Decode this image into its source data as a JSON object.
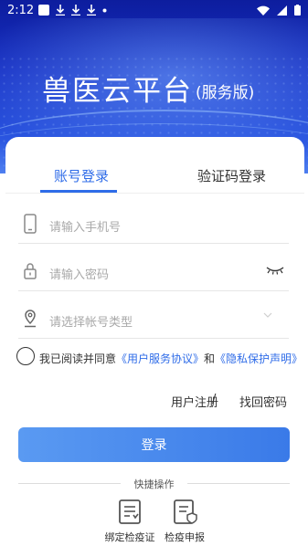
{
  "status_bar": {
    "time": "2:12"
  },
  "header": {
    "title": "兽医云平台",
    "subtitle": "(服务版)"
  },
  "tabs": [
    {
      "label": "账号登录",
      "active": true
    },
    {
      "label": "验证码登录",
      "active": false
    }
  ],
  "form": {
    "phone_placeholder": "请输入手机号",
    "password_placeholder": "请输入密码",
    "account_type_placeholder": "请选择帐号类型"
  },
  "agreement": {
    "prefix": "我已阅读并同意",
    "service_link": "《用户服务协议》",
    "and": "和",
    "privacy_link": "《隐私保护声明》"
  },
  "links": {
    "register": "用户注册",
    "separator": "/",
    "forgot": "找回密码"
  },
  "login_button": "登录",
  "quick_ops": {
    "title": "快捷操作",
    "items": [
      {
        "label": "绑定检疫证",
        "icon": "certificate-icon"
      },
      {
        "label": "检疫申报",
        "icon": "declaration-icon"
      }
    ]
  },
  "colors": {
    "accent": "#2f6ce8",
    "header_bg": "#1730c4",
    "button": "#4a8af0"
  }
}
